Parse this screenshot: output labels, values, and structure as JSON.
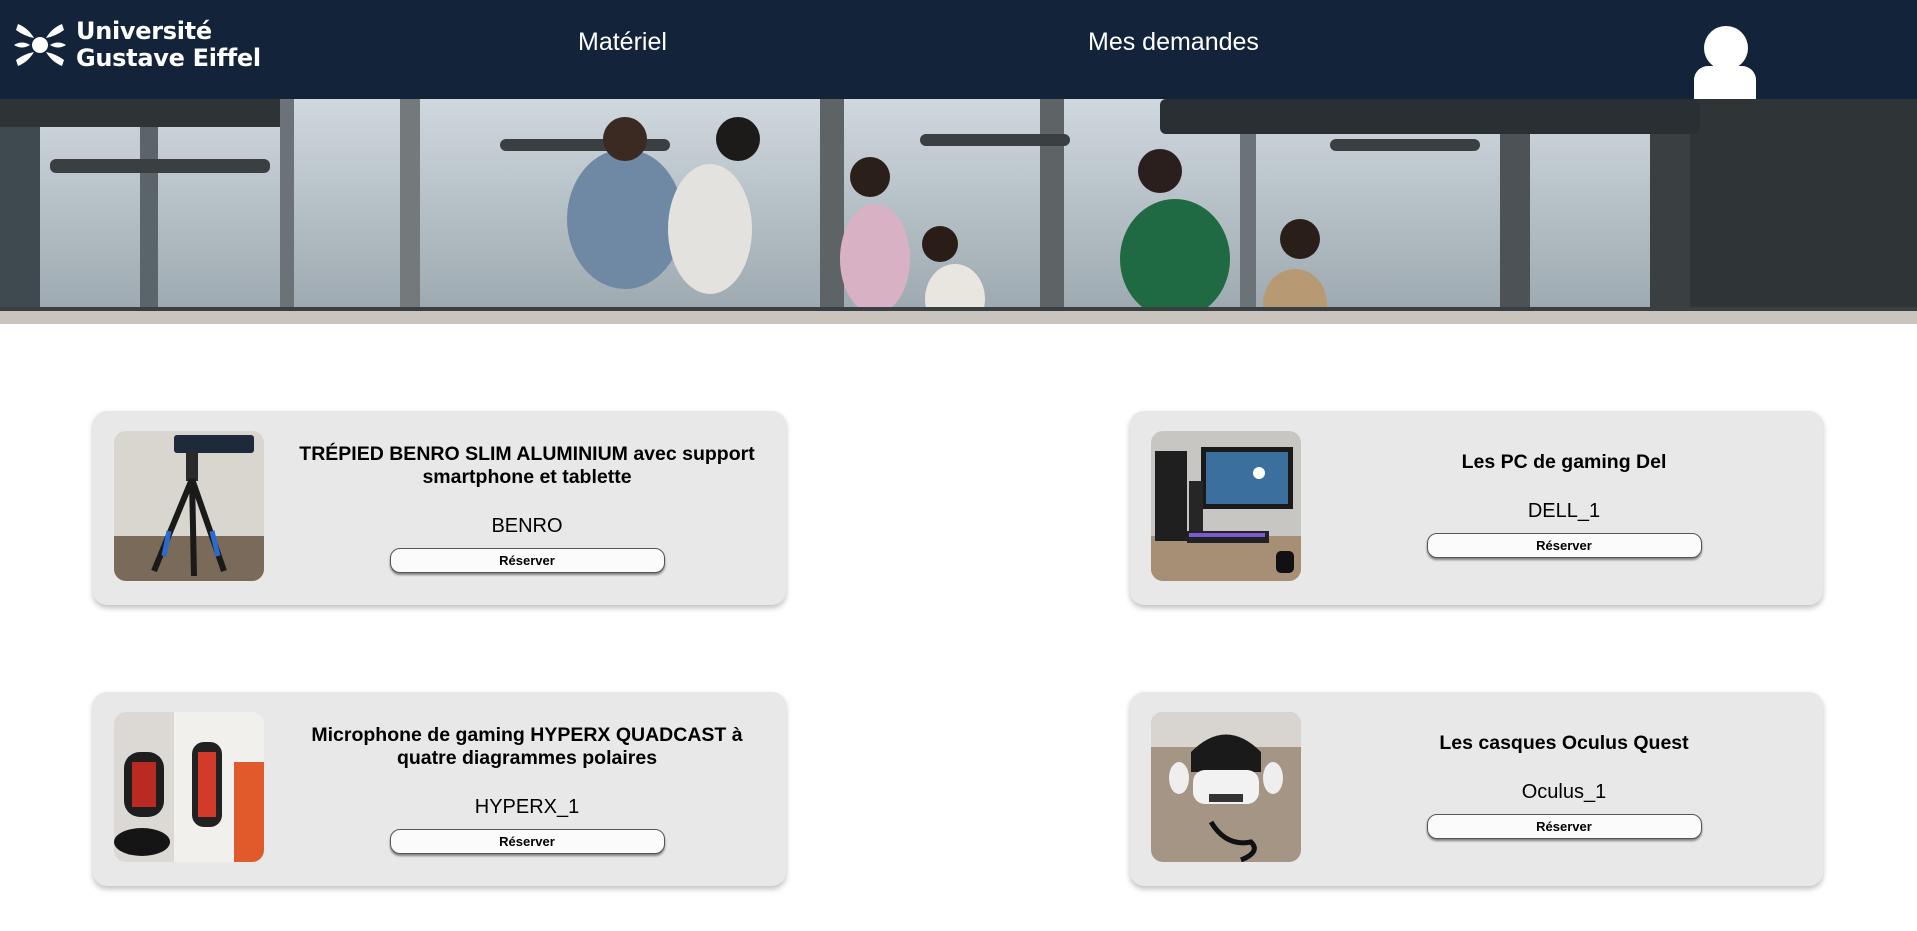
{
  "header": {
    "logo": {
      "line1": "Université",
      "line2": "Gustave Eiffel"
    },
    "nav": {
      "materiel": "Matériel",
      "demandes": "Mes demandes"
    },
    "profile_icon": "user-avatar-icon",
    "background_color": "#13243a"
  },
  "banner": {
    "image": "students-walking-library-photo"
  },
  "products": [
    {
      "title": "TRÉPIED BENRO SLIM ALUMINIUM avec support smartphone et tablette",
      "ref": "BENRO",
      "button": "Réserver",
      "image": "tripod-photo"
    },
    {
      "title": "Les PC de gaming Del",
      "ref": "DELL_1",
      "button": "Réserver",
      "image": "gaming-pc-photo"
    },
    {
      "title": "Microphone de gaming HYPERX QUADCAST à quatre diagrammes polaires",
      "ref": "HYPERX_1",
      "button": "Réserver",
      "image": "microphone-photo"
    },
    {
      "title": "Les casques Oculus Quest",
      "ref": "Oculus_1",
      "button": "Réserver",
      "image": "vr-headset-photo"
    }
  ],
  "colors": {
    "card_background": "#e8e8e8",
    "header": "#13243a"
  }
}
